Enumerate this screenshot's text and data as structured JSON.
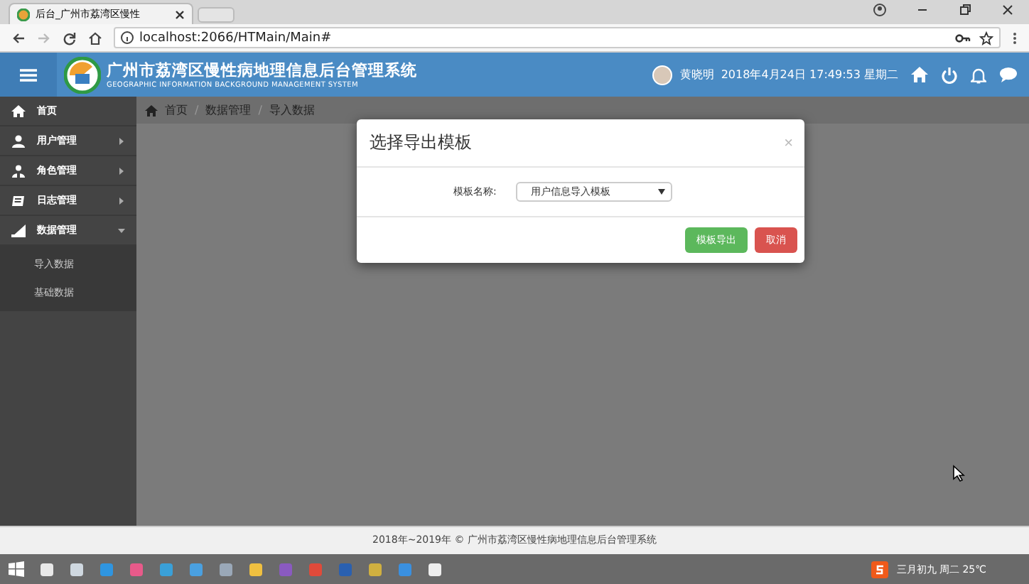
{
  "browser": {
    "tab_title": "后台_广州市荔湾区慢性",
    "url": "localhost:2066/HTMain/Main#"
  },
  "header": {
    "title": "广州市荔湾区慢性病地理信息后台管理系统",
    "subtitle": "GEOGRAPHIC INFORMATION BACKGROUND MANAGEMENT SYSTEM",
    "user": "黄晓明",
    "datetime": "2018年4月24日 17:49:53 星期二"
  },
  "sidebar": {
    "items": [
      {
        "label": "首页",
        "kind": "link"
      },
      {
        "label": "用户管理",
        "kind": "group",
        "expanded": false
      },
      {
        "label": "角色管理",
        "kind": "group",
        "expanded": false
      },
      {
        "label": "日志管理",
        "kind": "group",
        "expanded": false
      },
      {
        "label": "数据管理",
        "kind": "group",
        "expanded": true,
        "children": [
          {
            "label": "导入数据"
          },
          {
            "label": "基础数据"
          }
        ]
      }
    ]
  },
  "breadcrumb": {
    "separator": "/",
    "items": [
      "首页",
      "数据管理",
      "导入数据"
    ]
  },
  "modal": {
    "title": "选择导出模板",
    "close": "×",
    "field_label": "模板名称:",
    "select_value": "用户信息导入模板",
    "buttons": [
      {
        "label": "模板导出",
        "kind": "success"
      },
      {
        "label": "取消",
        "kind": "danger"
      }
    ]
  },
  "footer": "2018年~2019年 © 广州市荔湾区慢性病地理信息后台管理系统",
  "taskbar": {
    "tray_text": "三月初九 周二 25℃"
  }
}
